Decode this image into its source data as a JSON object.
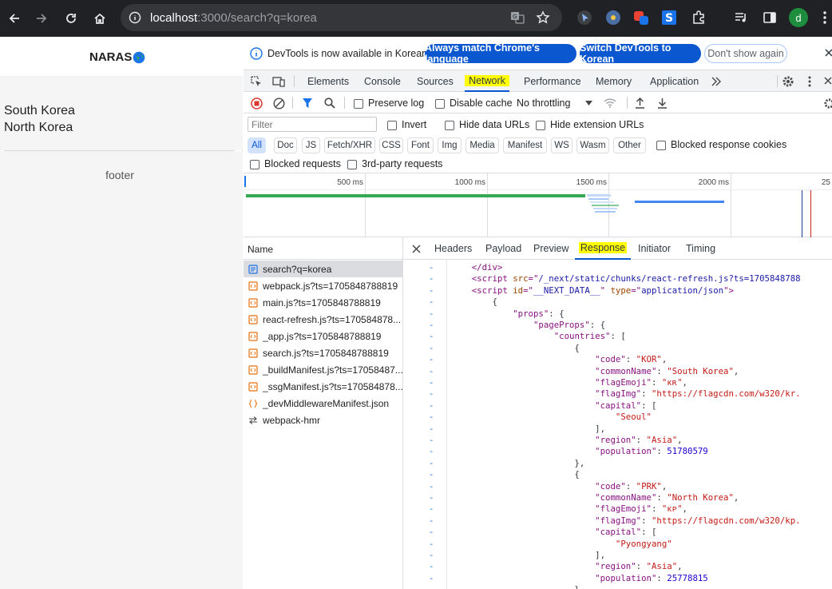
{
  "browser": {
    "url_host": "localhost",
    "url_rest": ":3000/search?q=korea",
    "profile_initial": "d",
    "colors": {
      "chrome_bg": "#202124",
      "omnibox_bg": "#35363a",
      "profile_bg": "#1e8e3e"
    }
  },
  "page": {
    "brand": "NARAS",
    "results": [
      "South Korea",
      "North Korea"
    ],
    "footer": "footer"
  },
  "devtools": {
    "infobar": {
      "message": "DevTools is now available in Korean!",
      "btn_match": "Always match Chrome's language",
      "btn_switch": "Switch DevTools to Korean",
      "btn_dismiss": "Don't show again"
    },
    "tabs": [
      "Elements",
      "Console",
      "Sources",
      "Network",
      "Performance",
      "Memory",
      "Application"
    ],
    "active_tab": "Network",
    "toolbar": {
      "preserve_log": "Preserve log",
      "disable_cache": "Disable cache",
      "throttling": "No throttling"
    },
    "filter": {
      "placeholder": "Filter",
      "invert": "Invert",
      "hide_data_urls": "Hide data URLs",
      "hide_extension_urls": "Hide extension URLs",
      "types": [
        "All",
        "Doc",
        "JS",
        "Fetch/XHR",
        "CSS",
        "Font",
        "Img",
        "Media",
        "Manifest",
        "WS",
        "Wasm",
        "Other"
      ],
      "blocked_cookies": "Blocked response cookies",
      "blocked_requests": "Blocked requests",
      "third_party": "3rd-party requests"
    },
    "timeline": {
      "ticks": [
        "500 ms",
        "1000 ms",
        "1500 ms",
        "2000 ms",
        "25"
      ]
    },
    "requests": {
      "header": "Name",
      "items": [
        {
          "name": "search?q=korea",
          "type": "doc"
        },
        {
          "name": "webpack.js?ts=1705848788819",
          "type": "js"
        },
        {
          "name": "main.js?ts=1705848788819",
          "type": "js"
        },
        {
          "name": "react-refresh.js?ts=170584878...",
          "type": "js"
        },
        {
          "name": "_app.js?ts=1705848788819",
          "type": "js"
        },
        {
          "name": "search.js?ts=1705848788819",
          "type": "js"
        },
        {
          "name": "_buildManifest.js?ts=17058487...",
          "type": "js"
        },
        {
          "name": "_ssgManifest.js?ts=170584878...",
          "type": "js"
        },
        {
          "name": "_devMiddlewareManifest.json",
          "type": "json"
        },
        {
          "name": "webpack-hmr",
          "type": "ws"
        }
      ]
    },
    "detail_tabs": [
      "Headers",
      "Payload",
      "Preview",
      "Response",
      "Initiator",
      "Timing"
    ],
    "active_detail_tab": "Response",
    "response": {
      "gutter": "-",
      "lines": [
        [
          {
            "t": "    </div>",
            "c": "tk"
          }
        ],
        [
          {
            "t": "    <script ",
            "c": "tk"
          },
          {
            "t": "src",
            "c": "at"
          },
          {
            "t": "=\"",
            "c": "tk"
          },
          {
            "t": "/_next/static/chunks/react-refresh.js?ts=1705848788",
            "c": "av"
          }
        ],
        [
          {
            "t": "    <script ",
            "c": "tk"
          },
          {
            "t": "id",
            "c": "at"
          },
          {
            "t": "=\"",
            "c": "tk"
          },
          {
            "t": "__NEXT_DATA__",
            "c": "av"
          },
          {
            "t": "\" ",
            "c": "tk"
          },
          {
            "t": "type",
            "c": "at"
          },
          {
            "t": "=\"",
            "c": "tk"
          },
          {
            "t": "application/json",
            "c": "av"
          },
          {
            "t": "\">",
            "c": "tk"
          }
        ],
        [
          {
            "t": "        {",
            "c": "pu"
          }
        ],
        [
          {
            "t": "            ",
            "c": "pu"
          },
          {
            "t": "\"props\"",
            "c": "ky"
          },
          {
            "t": ": {",
            "c": "pu"
          }
        ],
        [
          {
            "t": "                ",
            "c": "pu"
          },
          {
            "t": "\"pageProps\"",
            "c": "ky"
          },
          {
            "t": ": {",
            "c": "pu"
          }
        ],
        [
          {
            "t": "                    ",
            "c": "pu"
          },
          {
            "t": "\"countries\"",
            "c": "ky"
          },
          {
            "t": ": [",
            "c": "pu"
          }
        ],
        [
          {
            "t": "                        {",
            "c": "pu"
          }
        ],
        [
          {
            "t": "                            ",
            "c": "pu"
          },
          {
            "t": "\"code\"",
            "c": "ky"
          },
          {
            "t": ": ",
            "c": "pu"
          },
          {
            "t": "\"KOR\"",
            "c": "st"
          },
          {
            "t": ",",
            "c": "pu"
          }
        ],
        [
          {
            "t": "                            ",
            "c": "pu"
          },
          {
            "t": "\"commonName\"",
            "c": "ky"
          },
          {
            "t": ": ",
            "c": "pu"
          },
          {
            "t": "\"South Korea\"",
            "c": "st"
          },
          {
            "t": ",",
            "c": "pu"
          }
        ],
        [
          {
            "t": "                            ",
            "c": "pu"
          },
          {
            "t": "\"flagEmoji\"",
            "c": "ky"
          },
          {
            "t": ": ",
            "c": "pu"
          },
          {
            "t": "\"ᴋʀ\"",
            "c": "st"
          },
          {
            "t": ",",
            "c": "pu"
          }
        ],
        [
          {
            "t": "                            ",
            "c": "pu"
          },
          {
            "t": "\"flagImg\"",
            "c": "ky"
          },
          {
            "t": ": ",
            "c": "pu"
          },
          {
            "t": "\"https://flagcdn.com/w320/kr.",
            "c": "st"
          }
        ],
        [
          {
            "t": "                            ",
            "c": "pu"
          },
          {
            "t": "\"capital\"",
            "c": "ky"
          },
          {
            "t": ": [",
            "c": "pu"
          }
        ],
        [
          {
            "t": "                                ",
            "c": "pu"
          },
          {
            "t": "\"Seoul\"",
            "c": "st"
          }
        ],
        [
          {
            "t": "                            ],",
            "c": "pu"
          }
        ],
        [
          {
            "t": "                            ",
            "c": "pu"
          },
          {
            "t": "\"region\"",
            "c": "ky"
          },
          {
            "t": ": ",
            "c": "pu"
          },
          {
            "t": "\"Asia\"",
            "c": "st"
          },
          {
            "t": ",",
            "c": "pu"
          }
        ],
        [
          {
            "t": "                            ",
            "c": "pu"
          },
          {
            "t": "\"population\"",
            "c": "ky"
          },
          {
            "t": ": ",
            "c": "pu"
          },
          {
            "t": "51780579",
            "c": "nm"
          }
        ],
        [
          {
            "t": "                        },",
            "c": "pu"
          }
        ],
        [
          {
            "t": "                        {",
            "c": "pu"
          }
        ],
        [
          {
            "t": "                            ",
            "c": "pu"
          },
          {
            "t": "\"code\"",
            "c": "ky"
          },
          {
            "t": ": ",
            "c": "pu"
          },
          {
            "t": "\"PRK\"",
            "c": "st"
          },
          {
            "t": ",",
            "c": "pu"
          }
        ],
        [
          {
            "t": "                            ",
            "c": "pu"
          },
          {
            "t": "\"commonName\"",
            "c": "ky"
          },
          {
            "t": ": ",
            "c": "pu"
          },
          {
            "t": "\"North Korea\"",
            "c": "st"
          },
          {
            "t": ",",
            "c": "pu"
          }
        ],
        [
          {
            "t": "                            ",
            "c": "pu"
          },
          {
            "t": "\"flagEmoji\"",
            "c": "ky"
          },
          {
            "t": ": ",
            "c": "pu"
          },
          {
            "t": "\"ᴋᴘ\"",
            "c": "st"
          },
          {
            "t": ",",
            "c": "pu"
          }
        ],
        [
          {
            "t": "                            ",
            "c": "pu"
          },
          {
            "t": "\"flagImg\"",
            "c": "ky"
          },
          {
            "t": ": ",
            "c": "pu"
          },
          {
            "t": "\"https://flagcdn.com/w320/kp.",
            "c": "st"
          }
        ],
        [
          {
            "t": "                            ",
            "c": "pu"
          },
          {
            "t": "\"capital\"",
            "c": "ky"
          },
          {
            "t": ": [",
            "c": "pu"
          }
        ],
        [
          {
            "t": "                                ",
            "c": "pu"
          },
          {
            "t": "\"Pyongyang\"",
            "c": "st"
          }
        ],
        [
          {
            "t": "                            ],",
            "c": "pu"
          }
        ],
        [
          {
            "t": "                            ",
            "c": "pu"
          },
          {
            "t": "\"region\"",
            "c": "ky"
          },
          {
            "t": ": ",
            "c": "pu"
          },
          {
            "t": "\"Asia\"",
            "c": "st"
          },
          {
            "t": ",",
            "c": "pu"
          }
        ],
        [
          {
            "t": "                            ",
            "c": "pu"
          },
          {
            "t": "\"population\"",
            "c": "ky"
          },
          {
            "t": ": ",
            "c": "pu"
          },
          {
            "t": "25778815",
            "c": "nm"
          }
        ],
        [
          {
            "t": "                        }",
            "c": "pu"
          }
        ]
      ]
    }
  }
}
